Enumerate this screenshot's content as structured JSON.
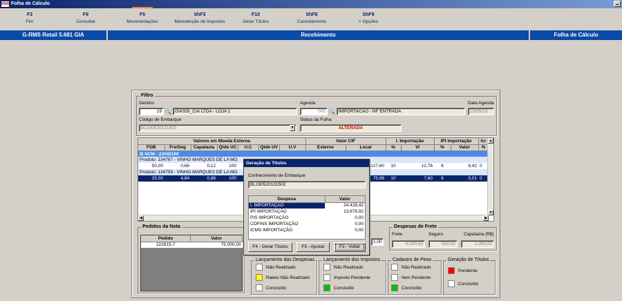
{
  "window": {
    "title": "Folha de Cálculo"
  },
  "fkeys": [
    {
      "key": "F3",
      "label": "Fim"
    },
    {
      "key": "F9",
      "label": "Consultar"
    },
    {
      "key": "F5",
      "label": "Movimentações"
    },
    {
      "key": "ShF3",
      "label": "Manutenção de Impostos"
    },
    {
      "key": "F10",
      "label": "Gerar Títulos"
    },
    {
      "key": "ShF8",
      "label": "Cancelamento"
    },
    {
      "key": "ShF9",
      "label": "+ Opções"
    }
  ],
  "infobar": {
    "app": "G-RMS Retail 5.681 GIA",
    "center": "Recebimento",
    "right": "Folha de Cálculo"
  },
  "filtro": {
    "title": "Filtro",
    "destino_label": "Destino",
    "destino_code": "19",
    "destino_name": "GIASSI_CIA LTDA - LOJA 1",
    "agenda_label": "Agenda",
    "agenda_code": "005",
    "agenda_name": "IMPORTACAO - NF ENTRADA",
    "data_agenda_label": "Data Agenda",
    "data_agenda": "15/05/13",
    "embarque_label": "Código de Embarque",
    "embarque": "BL150520131502",
    "status_label": "Status da Folha",
    "status": "ALTERADA"
  },
  "grid": {
    "group_headers": [
      "Valores em Moeda Externa",
      "Valor CIF",
      "I. Importação",
      "IPI Importação",
      "Icr"
    ],
    "columns": [
      "FOB",
      "Fre/Seg",
      "Capatazia",
      "Qtde UC",
      "U.C",
      "Qtde UV",
      "U.V",
      "Externo",
      "Local",
      "%",
      "Vl",
      "%",
      "Valor",
      "%"
    ],
    "ncm": "NCM : 22042100",
    "rows": [
      {
        "produto": "Produto: 134767 - VINHO MARQUES DE LA MO",
        "vals": [
          "50,00",
          "0,66",
          "0,12",
          "100"
        ],
        "local": "127,60",
        "ii_p": "10",
        "ii_v": "12,76",
        "ipi_p": "6",
        "ipi_v": "8,42",
        "x": "0"
      },
      {
        "produto": "Produto: 134759 - VINHO MARQUES DE LA MO",
        "vals": [
          "25,00",
          "4,84",
          "0,88",
          "100"
        ],
        "local": "75,98",
        "ii_p": "10",
        "ii_v": "7,60",
        "ipi_p": "6",
        "ipi_v": "5,01",
        "x": "0"
      }
    ]
  },
  "pedidos": {
    "title": "Pedidos da Nota",
    "col_pedido": "Pedido",
    "col_valor": "Valor",
    "rows": [
      {
        "pedido": "222815-7",
        "valor": "75.000,00"
      }
    ]
  },
  "frete": {
    "title": "Despesas de Frete",
    "frete_label": "Frete",
    "frete": "5.000,00",
    "seguro_label": "Seguro",
    "seguro": "500,00",
    "capatazia_label": "Capatazia (R$)",
    "capatazia": "1.000,00",
    "partial_value": "1,00"
  },
  "lanc_despesas": {
    "title": "Lançamento das Despesas",
    "items": [
      {
        "label": "Não Realizado",
        "color": "#ffffff"
      },
      {
        "label": "Rateio Não Realizado",
        "color": "#ffff00"
      },
      {
        "label": "Concluído",
        "color": "#ffffff"
      }
    ]
  },
  "lanc_impostos": {
    "title": "Lançamento dos Impostos",
    "items": [
      {
        "label": "Não Realizado",
        "color": "#ffffff"
      },
      {
        "label": "Imposto Pendente",
        "color": "#ffffff"
      },
      {
        "label": "Concluído",
        "color": "#00c000"
      }
    ]
  },
  "cadastro_peso": {
    "title": "Cadastro de Peso",
    "items": [
      {
        "label": "Não Realizado",
        "color": "#ffffff"
      },
      {
        "label": "Item Pendente",
        "color": "#ffffff"
      },
      {
        "label": "Concluído",
        "color": "#00c000"
      }
    ]
  },
  "geracao_titulos": {
    "title": "Geração de Títulos",
    "items": [
      {
        "label": "Pendente",
        "color": "#ff0000"
      },
      {
        "label": "Concluído",
        "color": "#ffffff"
      }
    ]
  },
  "dialog": {
    "title": "Geração de Títulos",
    "conhecimento_label": "Conhecimento de Embarque",
    "conhecimento": "BL150520131502",
    "col_despesa": "Despesa",
    "col_valor": "Valor",
    "rows": [
      {
        "despesa": "I. IMPORTAÇÃO",
        "valor": "24.428,42"
      },
      {
        "despesa": "IPI IMPORTAÇÃO",
        "valor": "13.679,92"
      },
      {
        "despesa": "PIS IMPORTAÇÃO",
        "valor": "0,00"
      },
      {
        "despesa": "COFINS IMPORTAÇÃO",
        "valor": "0,00"
      },
      {
        "despesa": "ICMS IMPORTAÇÃO",
        "valor": "0,00"
      }
    ],
    "btn_gerar": "F4 - Gerar Títulos",
    "btn_ajustar": "F5 - Ajustar",
    "btn_voltar": "F3 - Voltar"
  }
}
